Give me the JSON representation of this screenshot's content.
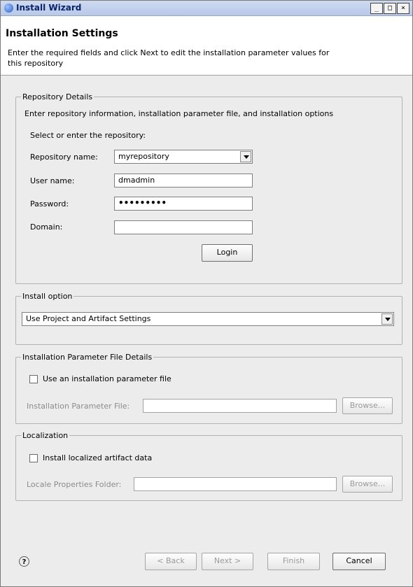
{
  "window": {
    "title": "Install Wizard",
    "buttons": [
      "_",
      "□",
      "×"
    ]
  },
  "header": {
    "title": "Installation Settings",
    "description": "Enter the required fields and click Next to edit the installation parameter values for this repository"
  },
  "repository": {
    "legend": "Repository Details",
    "intro": "Enter repository information, installation parameter file, and installation options",
    "select_prompt": "Select or enter the repository:",
    "name_label": "Repository name:",
    "name_value": "myrepository",
    "user_label": "User name:",
    "user_value": "dmadmin",
    "password_label": "Password:",
    "password_value": "•••••••••",
    "domain_label": "Domain:",
    "domain_value": "",
    "login_label": "Login"
  },
  "install_option": {
    "legend": "Install option",
    "selected": "Use Project and Artifact Settings"
  },
  "param_file": {
    "legend": "Installation Parameter File Details",
    "checkbox_label": "Use an installation parameter file",
    "checked": false,
    "field_label": "Installation Parameter File:",
    "field_value": "",
    "browse_label": "Browse..."
  },
  "localization": {
    "legend": "Localization",
    "checkbox_label": "Install localized artifact data",
    "checked": false,
    "field_label": "Locale Properties Folder:",
    "field_value": "",
    "browse_label": "Browse..."
  },
  "footer": {
    "help_icon": "?",
    "back_label": "< Back",
    "next_label": "Next >",
    "finish_label": "Finish",
    "cancel_label": "Cancel"
  }
}
